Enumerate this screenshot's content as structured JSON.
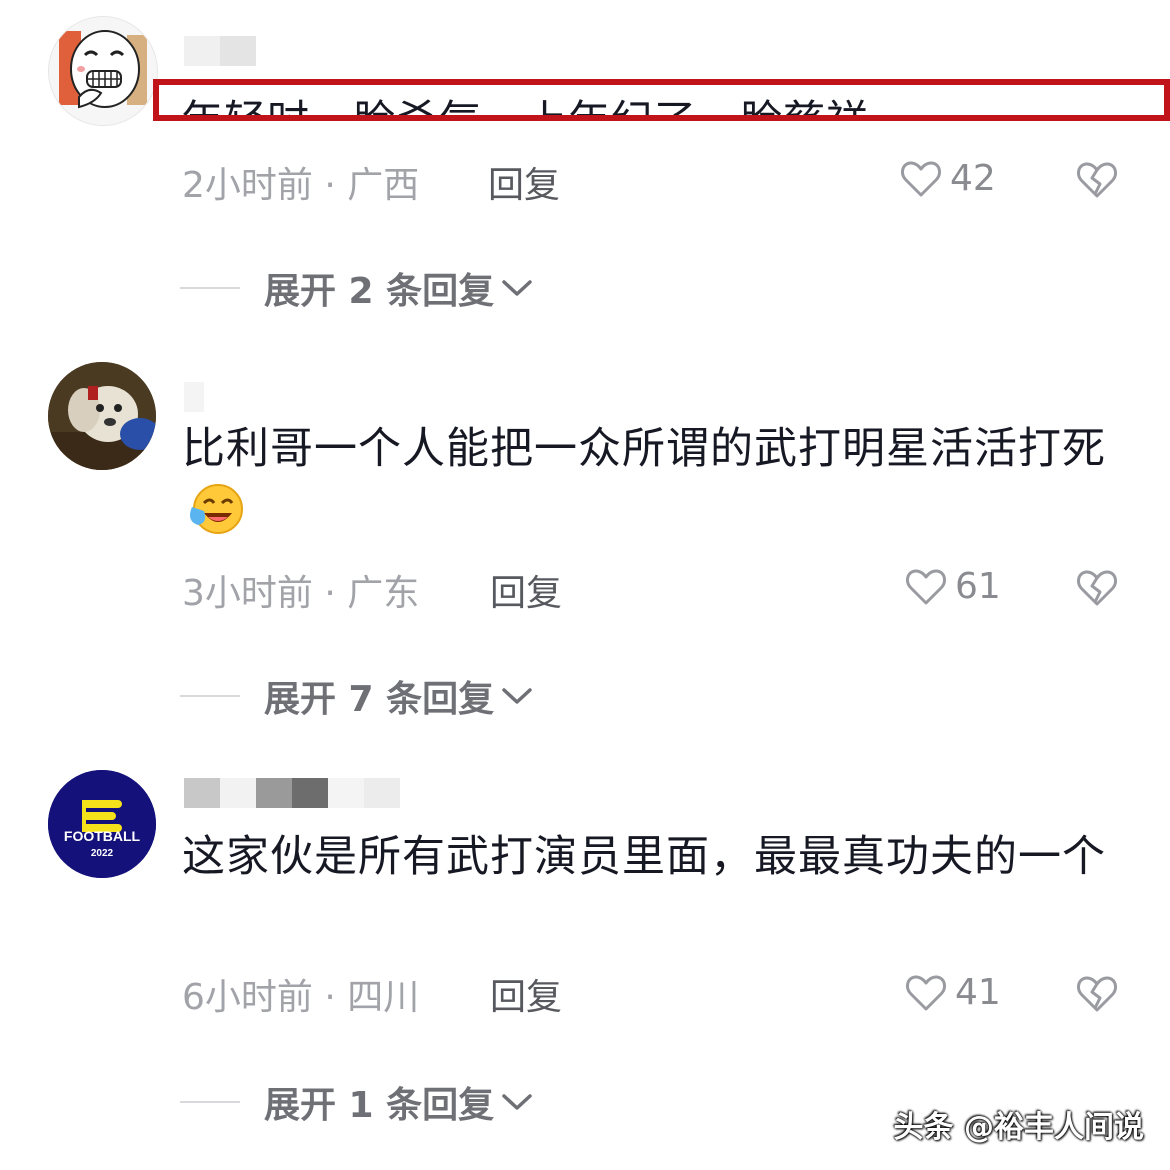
{
  "comments": [
    {
      "text": "年轻时一脸杀气，上年纪了一脸慈祥",
      "time_location": "2小时前 · 广西",
      "reply_label": "回复",
      "likes": "42",
      "expand_label": "展开 2 条回复"
    },
    {
      "text": "比利哥一个人能把一众所谓的武打明星活活打死",
      "time_location": "3小时前 · 广东",
      "reply_label": "回复",
      "likes": "61",
      "expand_label": "展开 7 条回复"
    },
    {
      "text": "这家伙是所有武打演员里面，最最真功夫的一个",
      "time_location": "6小时前 · 四川",
      "reply_label": "回复",
      "likes": "41",
      "expand_label": "展开 1 条回复",
      "avatar_text": [
        "FOOTBALL",
        "2022"
      ]
    }
  ],
  "watermark": "头条 @裕丰人间说",
  "icons": {
    "like": "heart-outline-icon",
    "dislike": "broken-heart-icon",
    "expand": "chevron-down-icon",
    "emoji": "laughing-crying-emoji-icon"
  },
  "colors": {
    "highlight": "#c0141a",
    "meta": "#a1a3a8",
    "text": "#161823",
    "efootball_bg": "#14127a",
    "efootball_accent": "#f5e21a"
  }
}
